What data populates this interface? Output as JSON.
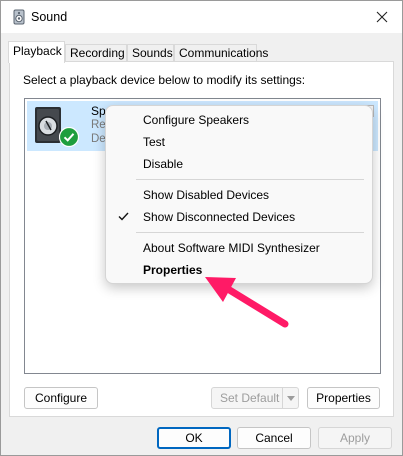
{
  "window": {
    "title": "Sound"
  },
  "tabs": [
    "Playback",
    "Recording",
    "Sounds",
    "Communications"
  ],
  "instruction": "Select a playback device below to modify its settings:",
  "device": {
    "name": "Spe",
    "line2": "Rea",
    "line3": "Def"
  },
  "context_menu": {
    "items": [
      "Configure Speakers",
      "Test",
      "Disable",
      "Show Disabled Devices",
      "Show Disconnected Devices",
      "About Software MIDI Synthesizer",
      "Properties"
    ],
    "checked": "Show Disconnected Devices",
    "bold": "Properties"
  },
  "panel_buttons": {
    "configure": "Configure",
    "set_default": "Set Default",
    "properties": "Properties"
  },
  "dialog_buttons": {
    "ok": "OK",
    "cancel": "Cancel",
    "apply": "Apply"
  },
  "colors": {
    "selection": "#cce8ff",
    "accent": "#0067c0",
    "annotation_arrow": "#ff1a66",
    "check_badge": "#1e9e3e"
  },
  "icons": [
    "speaker-app-icon",
    "close-icon",
    "speaker-device-icon",
    "default-check-badge-icon",
    "checkmark-icon",
    "dropdown-arrow-icon",
    "annotation-arrow-icon"
  ]
}
